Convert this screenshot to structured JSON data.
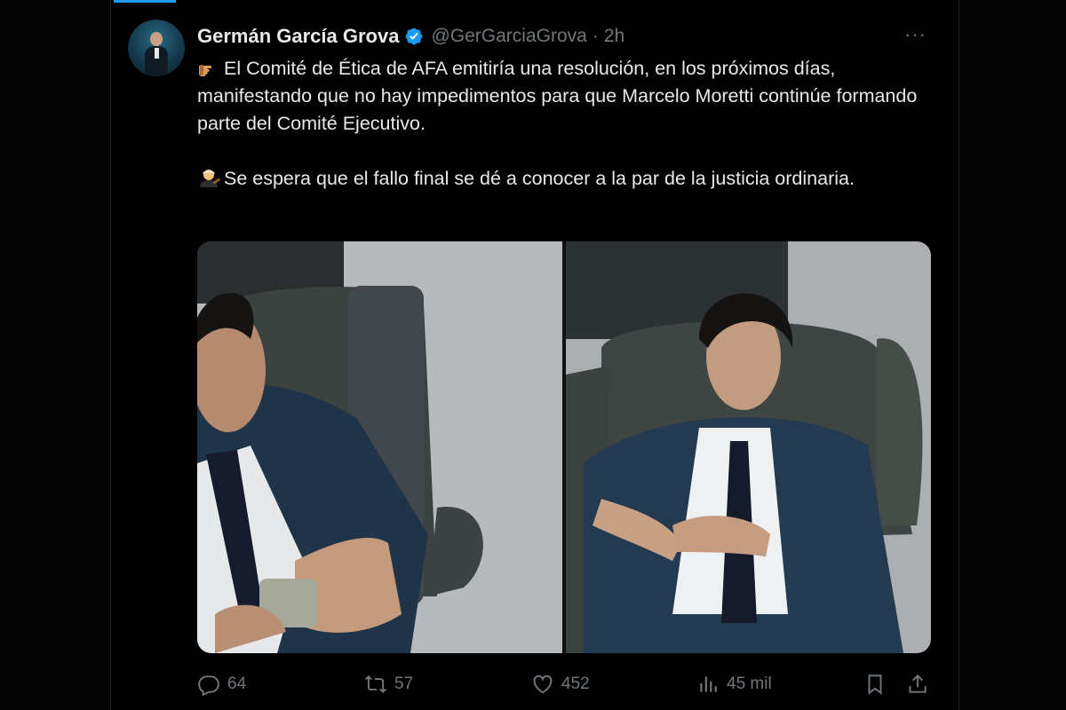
{
  "tweet": {
    "author_name": "Germán García Grova",
    "author_handle": "@GerGarciaGrova",
    "separator": "·",
    "time": "2h",
    "more_label": "···",
    "paragraph1": "El Comité de Ética de AFA emitiría una resolución, en los próximos días, manifestando que no hay impedimentos para que Marcelo Moretti continúe formando parte del Comité Ejecutivo.",
    "paragraph2": "Se espera que el fallo final se dé a conocer a la par de la justicia ordinaria.",
    "emoji1": "pointing-hand-emoji",
    "emoji2": "judge-emoji"
  },
  "media": {
    "photo_left": "man-in-armchair-counting-money-photo",
    "photo_right": "man-in-armchair-adjusting-jacket-photo"
  },
  "actions": {
    "replies": "64",
    "reposts": "57",
    "likes": "452",
    "views": "45 mil",
    "icons": [
      "reply-icon",
      "repost-icon",
      "like-icon",
      "views-icon",
      "bookmark-icon",
      "share-icon"
    ]
  },
  "colors": {
    "background": "#000000",
    "text": "#e7e9ea",
    "muted": "#71767b",
    "accent": "#1d9bf0"
  }
}
